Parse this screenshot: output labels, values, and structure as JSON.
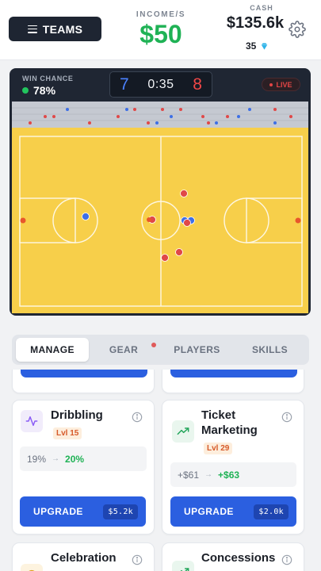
{
  "header": {
    "teams_label": "TEAMS",
    "income_label": "INCOME/S",
    "income_value": "$50",
    "cash_label": "CASH",
    "cash_value": "$135.6k",
    "gems_count": "35"
  },
  "match": {
    "win_chance_label": "WIN CHANCE",
    "win_chance_value": "78%",
    "home_score": "7",
    "clock": "0:35",
    "away_score": "8",
    "live_label": "LIVE",
    "home_color": "#4b82ff",
    "away_color": "#f04747",
    "court_color": "#f7cf4a"
  },
  "tabs": [
    {
      "label": "MANAGE",
      "active": true
    },
    {
      "label": "GEAR",
      "active": false
    },
    {
      "label": "PLAYERS",
      "active": false
    },
    {
      "label": "SKILLS",
      "active": false
    }
  ],
  "upgrades": [
    {
      "title_line1": "Dribbling",
      "title_line2": "",
      "level": "Lvl 15",
      "current": "19%",
      "next": "20%",
      "button_label": "UPGRADE",
      "cost": "$5.2k",
      "icon": "activity-icon"
    },
    {
      "title_line1": "Ticket",
      "title_line2": "Marketing",
      "level": "Lvl 29",
      "current": "+$61",
      "next": "+$63",
      "button_label": "UPGRADE",
      "cost": "$2.0k",
      "icon": "trending-up-icon"
    },
    {
      "title_line1": "Celebration",
      "title_line2": "",
      "icon": "trophy-icon"
    },
    {
      "title_line1": "Concessions",
      "title_line2": "",
      "icon": "trending-up-icon"
    }
  ]
}
